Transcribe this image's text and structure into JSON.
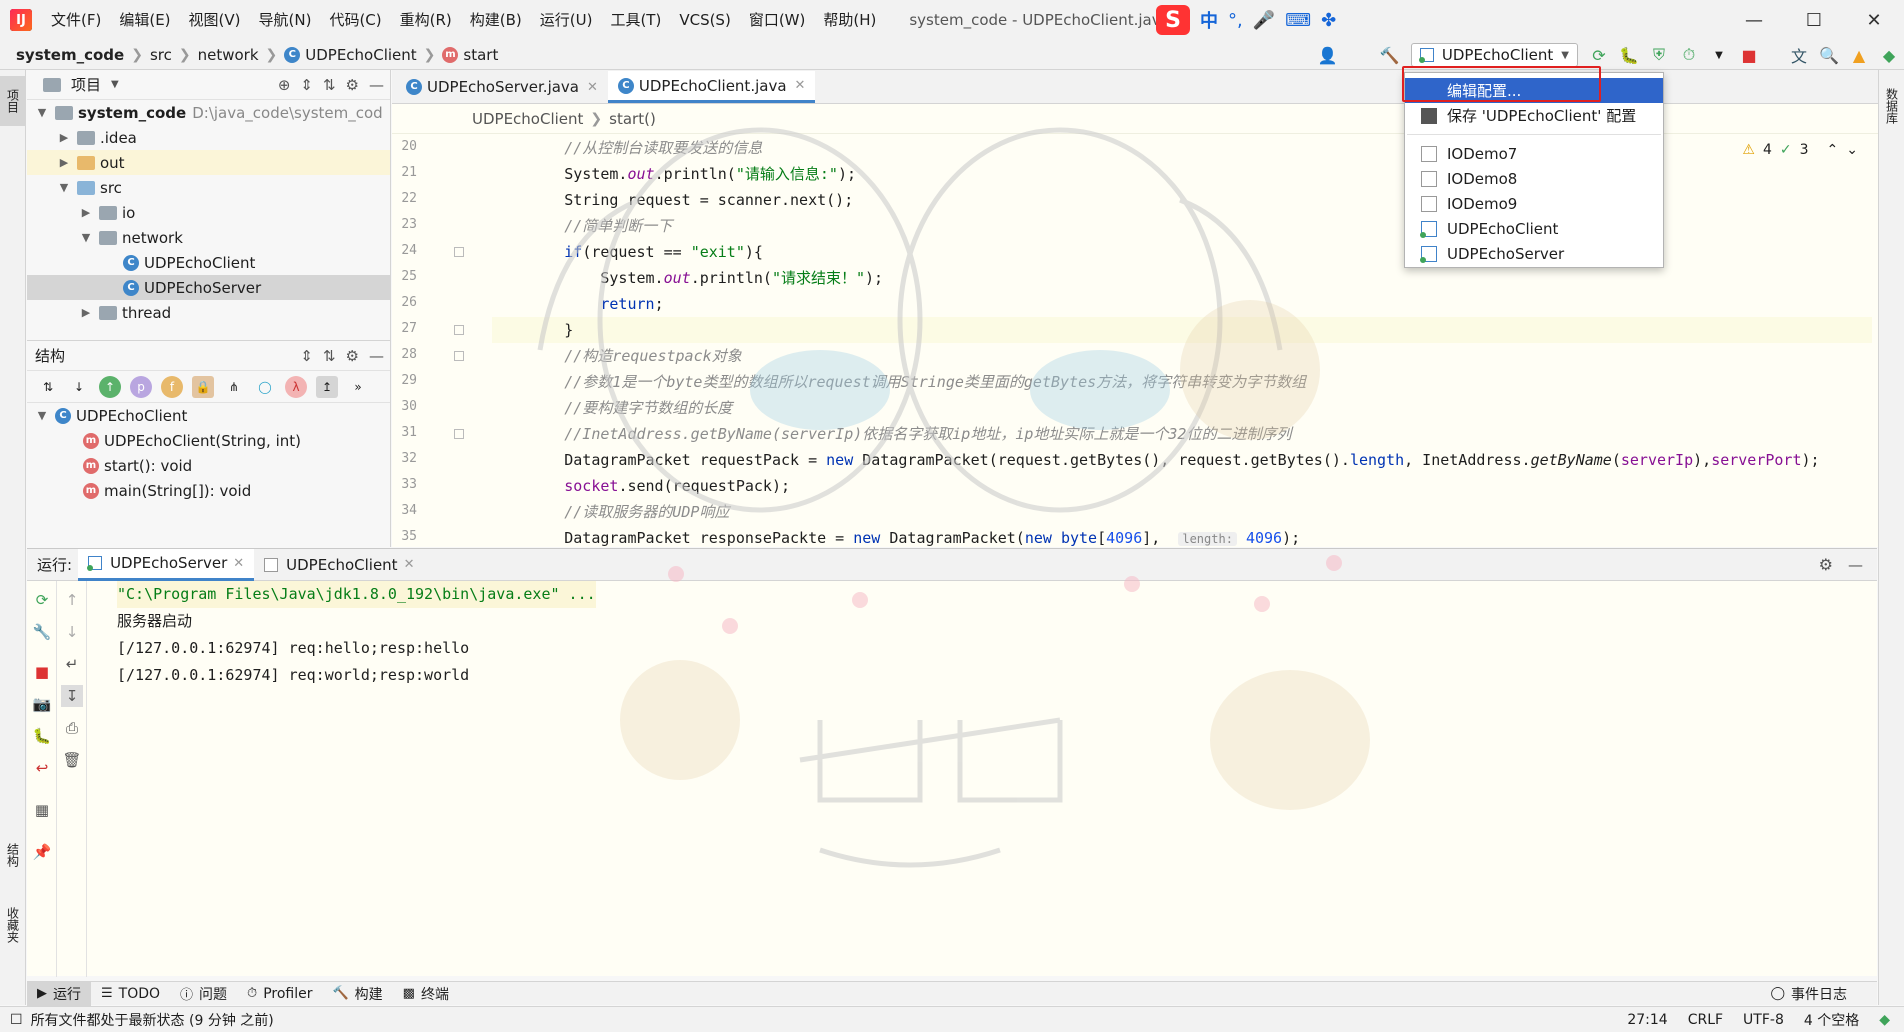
{
  "menu": [
    "文件(F)",
    "编辑(E)",
    "视图(V)",
    "导航(N)",
    "代码(C)",
    "重构(R)",
    "构建(B)",
    "运行(U)",
    "工具(T)",
    "VCS(S)",
    "窗口(W)",
    "帮助(H)"
  ],
  "window_title": "system_code - UDPEchoClient.java",
  "ime": {
    "logo": "S",
    "cn": "中",
    "punct": "°,",
    "mic": "🎤",
    "kbd": "⌨",
    "grid": "✤"
  },
  "breadcrumb": {
    "project": "system_code",
    "src": "src",
    "network": "network",
    "cls": "UDPEchoClient",
    "method": "start"
  },
  "run_config": "UDPEchoClient",
  "config_popup": {
    "edit": "编辑配置...",
    "save": "保存 'UDPEchoClient' 配置",
    "items": [
      "IODemo7",
      "IODemo8",
      "IODemo9",
      "UDPEchoClient",
      "UDPEchoServer"
    ]
  },
  "left_stripe": {
    "project": "项目",
    "structure": "结构",
    "favorites": "收藏夹"
  },
  "right_stripe": {
    "database": "数据库"
  },
  "project_panel": {
    "title": "项目",
    "root": "system_code",
    "root_path": "D:\\java_code\\system_cod",
    "nodes": [
      ".idea",
      "out",
      "src",
      "io",
      "network",
      "UDPEchoClient",
      "UDPEchoServer",
      "thread"
    ]
  },
  "structure_panel": {
    "title": "结构",
    "cls": "UDPEchoClient",
    "members": [
      "UDPEchoClient(String, int)",
      "start(): void",
      "main(String[]): void"
    ]
  },
  "editor": {
    "tabs": [
      "UDPEchoServer.java",
      "UDPEchoClient.java"
    ],
    "breadcrumb": [
      "UDPEchoClient",
      "start()"
    ],
    "warnings": "4",
    "checks": "3",
    "line_numbers": [
      "20",
      "21",
      "22",
      "23",
      "24",
      "25",
      "26",
      "27",
      "28",
      "29",
      "30",
      "31",
      "32",
      "33",
      "34",
      "35"
    ],
    "param_hint": "length:"
  },
  "run_panel": {
    "label": "运行:",
    "tabs": [
      "UDPEchoServer",
      "UDPEchoClient"
    ],
    "output": [
      "\"C:\\Program Files\\Java\\jdk1.8.0_192\\bin\\java.exe\" ...",
      "服务器启动",
      "[/127.0.0.1:62974] req:hello;resp:hello",
      "[/127.0.0.1:62974] req:world;resp:world"
    ]
  },
  "bottom_tabs": [
    "运行",
    "TODO",
    "问题",
    "Profiler",
    "构建",
    "终端"
  ],
  "event_log": "事件日志",
  "status": {
    "message": "所有文件都处于最新状态 (9 分钟 之前)",
    "position": "27:14",
    "line_sep": "CRLF",
    "encoding": "UTF-8",
    "indent": "4 个空格"
  },
  "colors": {
    "accent": "#2f65ca",
    "tab_underline": "#4083c9",
    "highlight_box": "#e02020"
  }
}
